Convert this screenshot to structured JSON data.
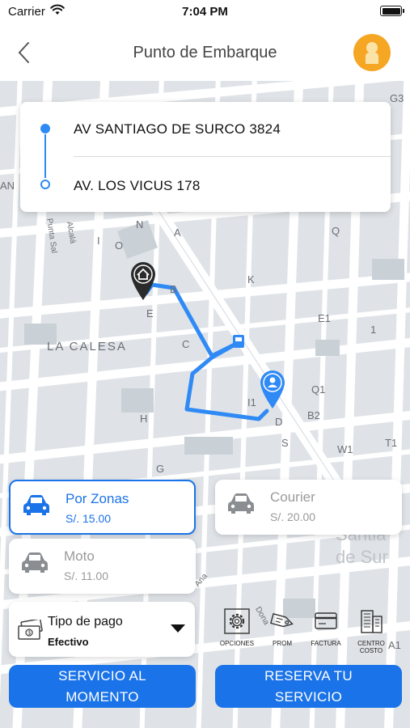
{
  "status_bar": {
    "carrier": "Carrier",
    "time": "7:04 PM"
  },
  "nav": {
    "title": "Punto de Embarque"
  },
  "trip": {
    "origin": "AV SANTIAGO DE SURCO 3824",
    "destination": "AV. LOS VICUS 178"
  },
  "map": {
    "labels": [
      "LA CALESA",
      "Santia",
      "de Sur",
      "Ana",
      "Alcalá",
      "Punta Sal",
      "Dona",
      "E",
      "B",
      "C",
      "A",
      "N",
      "O",
      "K",
      "D",
      "H",
      "G",
      "S",
      "Q1",
      "B2",
      "W1",
      "T1",
      "A1",
      "E1",
      "I1",
      "G3",
      "AN",
      "Q",
      "I",
      "1"
    ]
  },
  "services": [
    {
      "name": "Por Zonas",
      "price": "S/. 15.00",
      "selected": true
    },
    {
      "name": "Courier",
      "price": "S/. 20.00",
      "selected": false
    },
    {
      "name": "Moto",
      "price": "S/. 11.00",
      "selected": false
    }
  ],
  "payment": {
    "title": "Tipo de pago",
    "value": "Efectivo"
  },
  "options": [
    {
      "label": "OPCIONES",
      "icon": "gear-icon"
    },
    {
      "label": "PROM",
      "icon": "tag-icon"
    },
    {
      "label": "FACTURA",
      "icon": "invoice-card-icon"
    },
    {
      "label": "CENTRO COSTO",
      "icon": "building-icon"
    }
  ],
  "actions": {
    "now_line1": "SERVICIO AL",
    "now_line2": "MOMENTO",
    "reserve_line1": "RESERVA TU",
    "reserve_line2": "SERVICIO"
  },
  "colors": {
    "accent": "#1a73e8",
    "route": "#2f8af5",
    "avatar_bg": "#f5a623"
  }
}
